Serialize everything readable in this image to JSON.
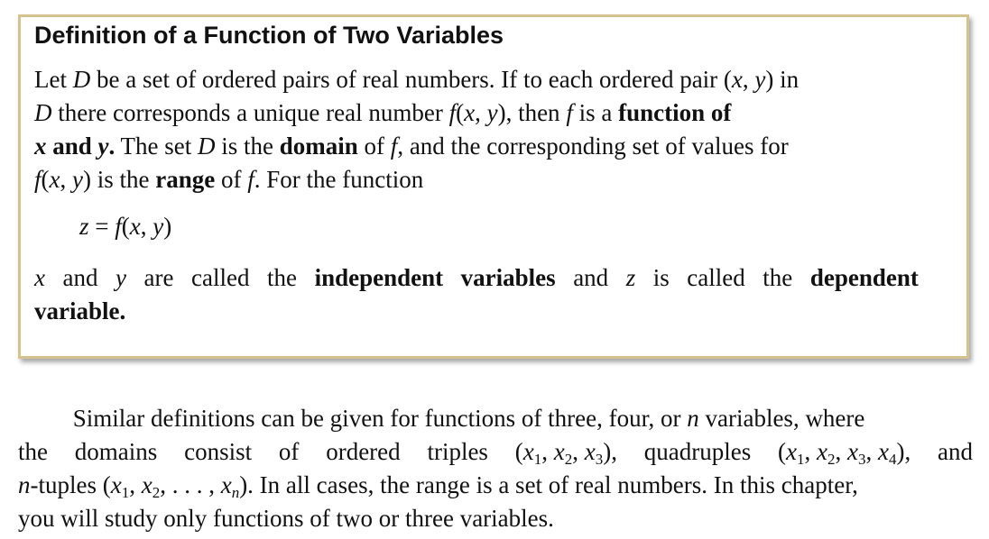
{
  "definition_box": {
    "title": "Definition of a Function of Two Variables",
    "lines": [
      "Let D be a set of ordered pairs of real numbers. If to each ordered pair (x, y) in",
      "D there corresponds a unique real number f(x, y), then f is a function of",
      "x and y. The set D is the domain of f, and the corresponding set of values for",
      "f(x, y) is the range of f. For the function"
    ],
    "equation": "z = f(x, y)",
    "lines2": [
      "x and y are called the independent variables and z is called the dependent",
      "variable."
    ],
    "bold_terms": [
      "function of",
      "x and y.",
      "domain",
      "range",
      "independent variables",
      "dependent",
      "variable."
    ]
  },
  "body_text": {
    "lines": [
      "Similar definitions can be given for functions of three, four, or n variables, where",
      "the domains consist of ordered triples (x1, x2, x3), quadruples (x1, x2, x3, x4), and",
      "n-tuples (x1, x2, . . . , xn). In all cases, the range is a set of real numbers. In this chapter,",
      "you will study only functions of two or three variables."
    ]
  },
  "colors": {
    "box_border": "#d4c28f",
    "text": "#111111"
  }
}
